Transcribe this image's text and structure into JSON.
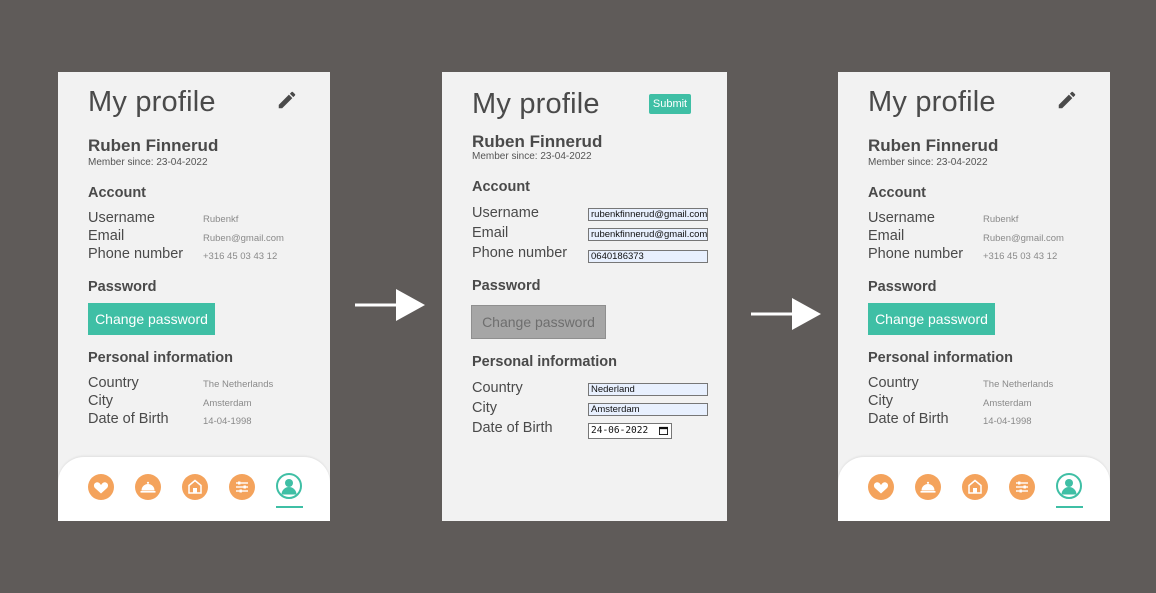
{
  "colors": {
    "background": "#5f5b59",
    "panel": "#f2f2f2",
    "accent": "#3fbfa5",
    "nav_icon": "#f4a35c",
    "disabled": "#a6a6a6"
  },
  "screen1": {
    "title": "My profile",
    "edit_icon": "pencil-icon",
    "name": "Ruben Finnerud",
    "member_since": "Member since: 23-04-2022",
    "account_heading": "Account",
    "username_label": "Username",
    "username_value": "Rubenkf",
    "email_label": "Email",
    "email_value": "Ruben@gmail.com",
    "phone_label": "Phone number",
    "phone_value": "+316 45 03 43 12",
    "password_heading": "Password",
    "change_password": "Change password",
    "personal_heading": "Personal information",
    "country_label": "Country",
    "country_value": "The Netherlands",
    "city_label": "City",
    "city_value": "Amsterdam",
    "dob_label": "Date of Birth",
    "dob_value": "14-04-1998",
    "nav": [
      "heart-icon",
      "cloche-icon",
      "home-icon",
      "sliders-icon",
      "profile-icon"
    ]
  },
  "screen2": {
    "title": "My profile",
    "submit": "Submit",
    "name": "Ruben Finnerud",
    "member_since": "Member since: 23-04-2022",
    "account_heading": "Account",
    "username_label": "Username",
    "username_input": "rubenkfinnerud@gmail.com",
    "email_label": "Email",
    "email_input": "rubenkfinnerud@gmail.com",
    "phone_label": "Phone number",
    "phone_input": "0640186373",
    "password_heading": "Password",
    "change_password": "Change password",
    "personal_heading": "Personal information",
    "country_label": "Country",
    "country_input": "Nederland",
    "city_label": "City",
    "city_input": "Amsterdam",
    "dob_label": "Date of Birth",
    "dob_input": "24-06-2022"
  },
  "screen3": {
    "title": "My profile",
    "edit_icon": "pencil-icon",
    "name": "Ruben Finnerud",
    "member_since": "Member since: 23-04-2022",
    "account_heading": "Account",
    "username_label": "Username",
    "username_value": "Rubenkf",
    "email_label": "Email",
    "email_value": "Ruben@gmail.com",
    "phone_label": "Phone number",
    "phone_value": "+316 45 03 43 12",
    "password_heading": "Password",
    "change_password": "Change password",
    "personal_heading": "Personal information",
    "country_label": "Country",
    "country_value": "The Netherlands",
    "city_label": "City",
    "city_value": "Amsterdam",
    "dob_label": "Date of Birth",
    "dob_value": "14-04-1998",
    "nav": [
      "heart-icon",
      "cloche-icon",
      "home-icon",
      "sliders-icon",
      "profile-icon"
    ]
  },
  "arrows": [
    "arrow-right-icon",
    "arrow-right-icon"
  ]
}
